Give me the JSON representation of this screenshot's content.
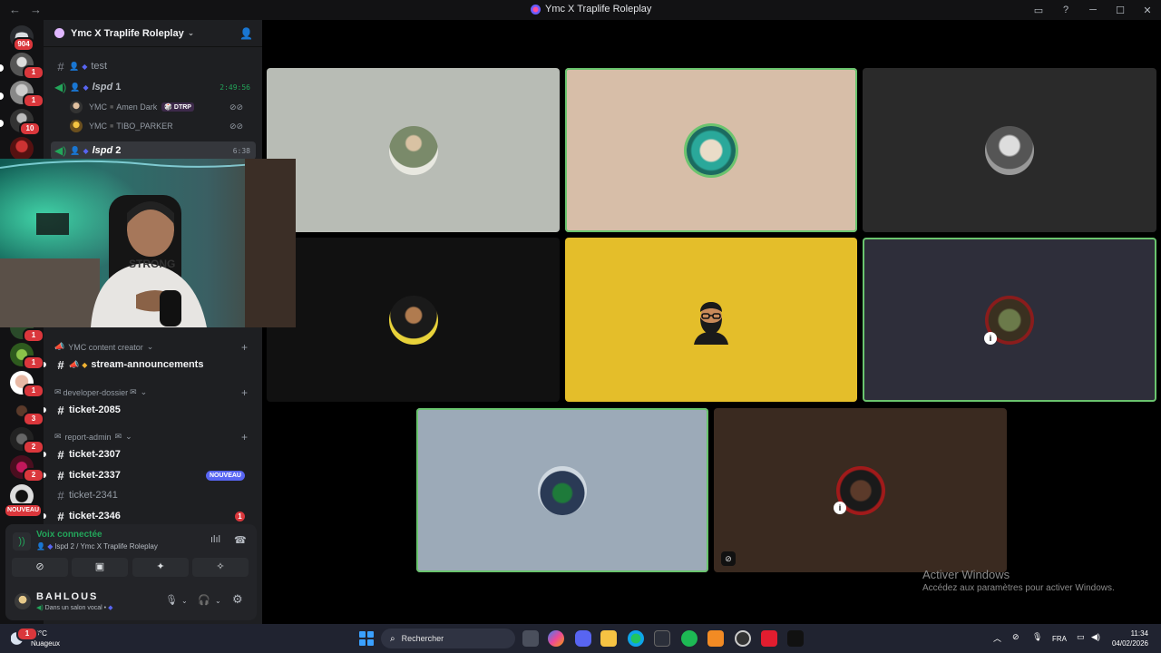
{
  "window": {
    "title": "Ymc X Traplife Roleplay",
    "nav_back": "←",
    "nav_forward": "→",
    "controls": [
      "▭",
      "?",
      "─",
      "☐",
      "✕"
    ]
  },
  "rail": {
    "dm_badge": "904",
    "server_badges": [
      "1",
      "1",
      "10",
      "1",
      "1",
      "1",
      "3",
      "2",
      "2"
    ],
    "nouveau": "NOUVEAU"
  },
  "guild": {
    "name": "Ymc X Traplife Roleplay",
    "chevron": "⌄"
  },
  "channels": {
    "test": "test",
    "lspd1": "lspd",
    "lspd1_count": "1",
    "lspd1_timer": "2:49:56",
    "member1_prefix": "YMC",
    "member1_name": "Amen Dark",
    "member1_tag": "DTRP",
    "member2_prefix": "YMC",
    "member2_name": "TIBO_PARKER",
    "lspd2": "lspd",
    "lspd2_count": "2",
    "lspd2_timer": "6:38",
    "cat_creator": "YMC content creator",
    "stream": "stream-announcements",
    "cat_dev": "developer-dossier",
    "ticket2085": "ticket-2085",
    "cat_report": "report-admin",
    "ticket2307": "ticket-2307",
    "ticket2337": "ticket-2337",
    "nouveau": "NOUVEAU",
    "ticket2341": "ticket-2341",
    "ticket2346": "ticket-2346",
    "ticket2346_badge": "1"
  },
  "voice": {
    "status": "Voix connectée",
    "sub": "lspd 2 / Ymc X Traplife Roleplay"
  },
  "user": {
    "name": "BAHLOUS",
    "status": "Dans un salon vocal •"
  },
  "activation": {
    "title": "Activer Windows",
    "sub": "Accédez aux paramètres pour activer Windows."
  },
  "taskbar": {
    "temp": "13°C",
    "weather": "Nuageux",
    "weather_badge": "1",
    "search": "Rechercher",
    "lang": "FRA",
    "time": "11:34",
    "date": "04/02/2026"
  },
  "colors": {
    "speaking_border": "#6ac46e",
    "accent": "#5865f2",
    "online": "#23a55a",
    "danger": "#da373c"
  }
}
